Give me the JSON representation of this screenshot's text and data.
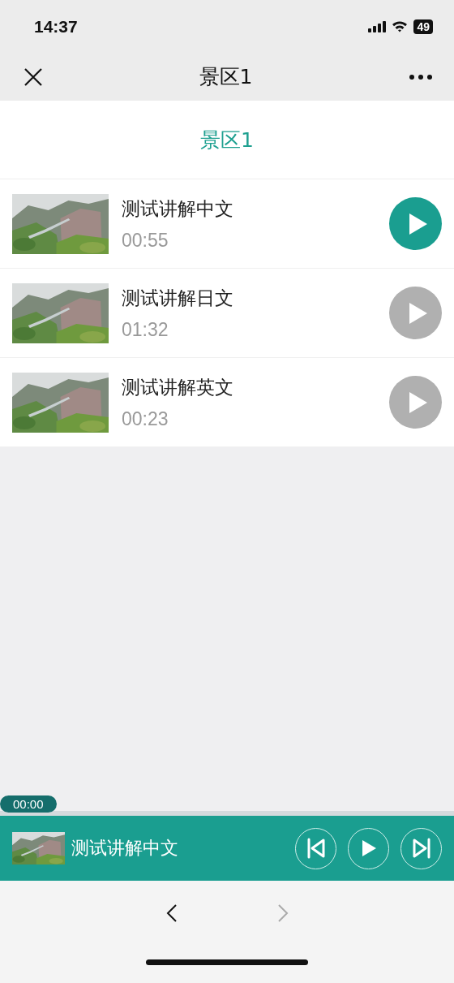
{
  "status_bar": {
    "time": "14:37",
    "battery": "49"
  },
  "nav_bar": {
    "title": "景区1"
  },
  "header": {
    "title": "景区1"
  },
  "tracks": [
    {
      "title": "测试讲解中文",
      "duration": "00:55",
      "selected": true
    },
    {
      "title": "测试讲解日文",
      "duration": "01:32",
      "selected": false
    },
    {
      "title": "测试讲解英文",
      "duration": "00:23",
      "selected": false
    }
  ],
  "player": {
    "time": "00:00",
    "level": 0,
    "title": "测试讲解中文"
  },
  "browser_nav": [
    {
      "kind": "back",
      "disabled": false
    },
    {
      "kind": "forward",
      "disabled": true
    }
  ]
}
